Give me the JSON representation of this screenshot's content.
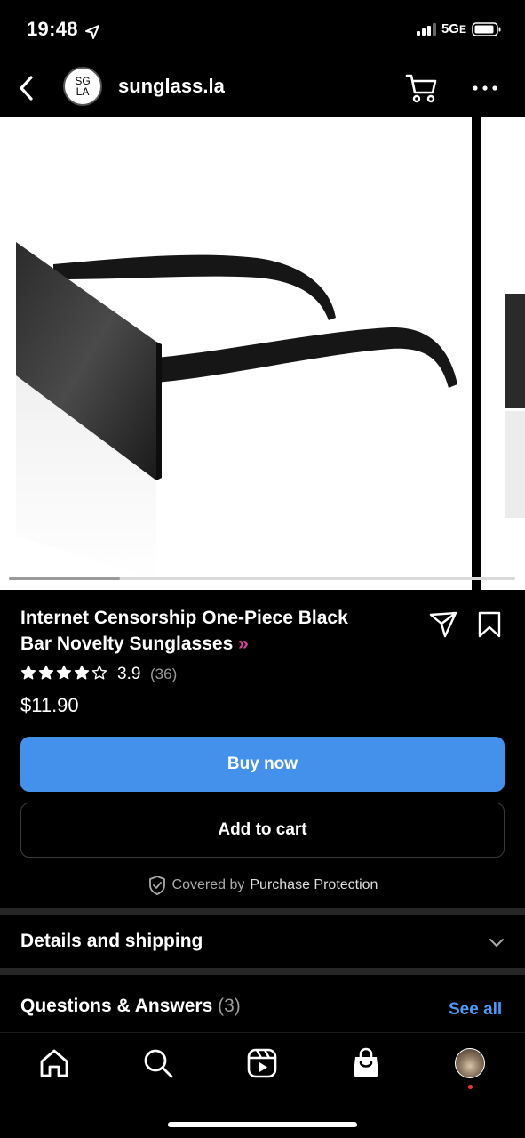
{
  "status": {
    "time": "19:48",
    "network": "5G",
    "network_suffix": "E"
  },
  "header": {
    "shop_logo_text_top": "SG",
    "shop_logo_text_bottom": "LA",
    "shop_name": "sunglass.la"
  },
  "gallery": {
    "progress": 0.22
  },
  "product": {
    "title_line1": "Internet Censorship One-Piece Black",
    "title_line2": "Bar Novelty Sunglasses",
    "title_suffix": "»",
    "rating": "3.9",
    "rating_count": "(36)",
    "stars_filled": 3.9,
    "price": "$11.90"
  },
  "actions": {
    "buy_now": "Buy now",
    "add_to_cart": "Add to cart"
  },
  "protection": {
    "prefix": "Covered by",
    "link": "Purchase Protection"
  },
  "sections": {
    "details": "Details and shipping",
    "qa_title": "Questions & Answers",
    "qa_count": "(3)",
    "see_all": "See all"
  },
  "colors": {
    "accent": "#4491ec",
    "link": "#4a9bf5",
    "badge": "#d2459b"
  },
  "icons": [
    "back-icon",
    "cart-icon",
    "more-icon",
    "share-icon",
    "save-icon",
    "shield-check-icon",
    "chevron-down-icon",
    "home-icon",
    "search-icon",
    "reels-icon",
    "shop-icon"
  ]
}
